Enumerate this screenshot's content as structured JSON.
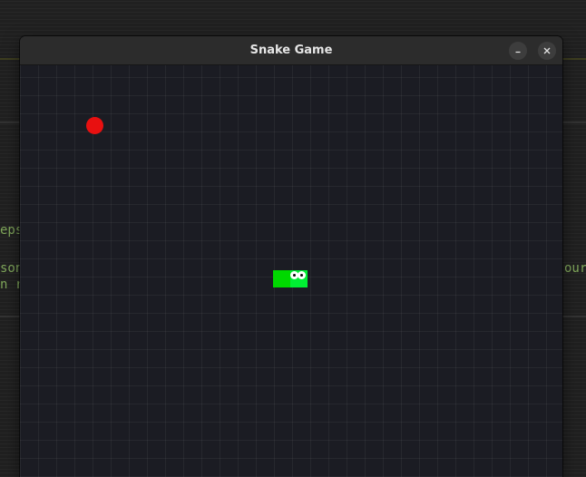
{
  "window": {
    "title": "Snake Game",
    "minimize_icon": "minimize-icon",
    "close_icon": "close-icon"
  },
  "background_terminal": {
    "visible_fragments": [
      "eps",
      "son",
      "n r",
      "our"
    ]
  },
  "game": {
    "food": {
      "icon": "apple-dot",
      "color": "#e81010"
    },
    "snake": {
      "length_segments": 2,
      "direction": "right",
      "head_color": "#00ee33",
      "body_color": "#00d800"
    },
    "board_color": "#1b1c23"
  }
}
